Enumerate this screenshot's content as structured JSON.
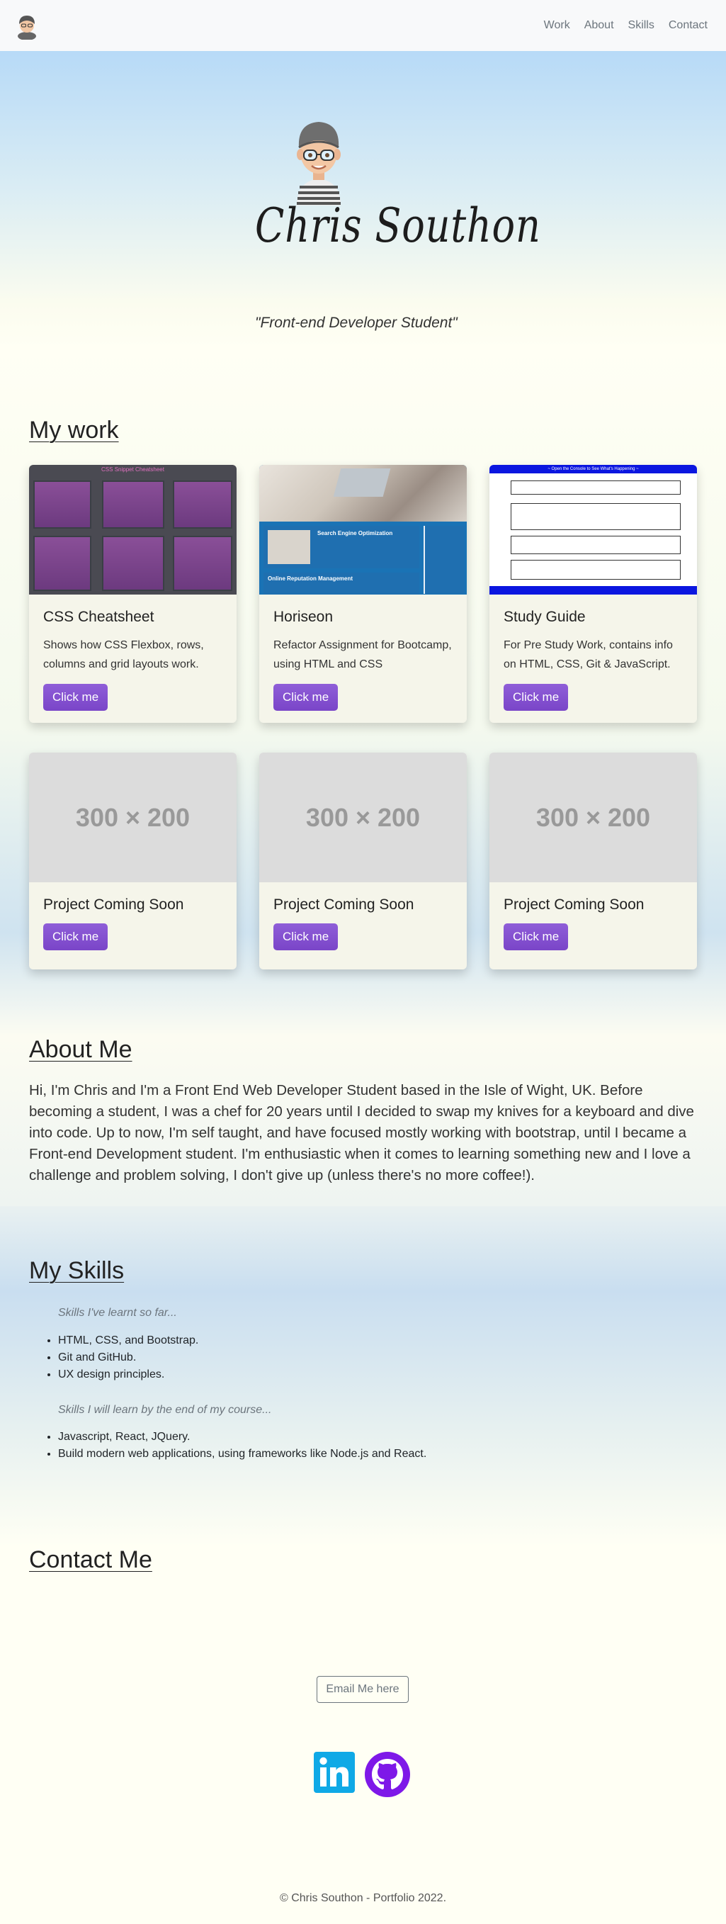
{
  "nav": {
    "logo_icon": "memoji-avatar-icon",
    "links": [
      "Work",
      "About",
      "Skills",
      "Contact"
    ]
  },
  "hero": {
    "name": "Chris Southon",
    "role": "\"Front-end Developer Student\"",
    "avatar_icon": "memoji-avatar-icon"
  },
  "work": {
    "heading": "My work",
    "projects": [
      {
        "title": "CSS Cheatsheet",
        "text": "Shows how CSS Flexbox, rows, columns and grid layouts work.",
        "button": "Click me",
        "thumb_title": "CSS Snippet Cheatsheet"
      },
      {
        "title": "Horiseon",
        "text": "Refactor Assignment for Bootcamp, using HTML and CSS",
        "button": "Click me",
        "thumb_title": "Search Engine Optimization",
        "thumb_title_2": "Online Reputation Management"
      },
      {
        "title": "Study Guide",
        "text": "For Pre Study Work, contains info on HTML, CSS, Git & JavaScript.",
        "button": "Click me",
        "thumb_title": "~ Open the Console to See What's Happening ~"
      }
    ],
    "coming_soon": [
      {
        "placeholder": "300 × 200",
        "title": "Project Coming Soon",
        "button": "Click me"
      },
      {
        "placeholder": "300 × 200",
        "title": "Project Coming Soon",
        "button": "Click me"
      },
      {
        "placeholder": "300 × 200",
        "title": "Project Coming Soon",
        "button": "Click me"
      }
    ]
  },
  "about": {
    "heading": "About Me",
    "text": "Hi, I'm Chris and I'm a Front End Web Developer Student based in the Isle of Wight, UK. Before becoming a student, I was a chef for 20 years until I decided to swap my knives for a keyboard and dive into code. Up to now, I'm self taught, and have focused mostly working with bootstrap, until I became a Front-end Development student. I'm enthusiastic when it comes to learning something new and I love a challenge and problem solving, I don't give up (unless there's no more coffee!)."
  },
  "skills": {
    "heading": "My Skills",
    "learnt_caption": "Skills I've learnt so far...",
    "learnt": [
      "HTML, CSS, and Bootstrap.",
      "Git and GitHub.",
      "UX design principles."
    ],
    "future_caption": "Skills I will learn by the end of my course...",
    "future": [
      "Javascript, React, JQuery.",
      "Build modern web applications, using frameworks like Node.js and React."
    ]
  },
  "contact": {
    "heading": "Contact Me",
    "email_button": "Email Me here",
    "socials": [
      "linkedin-icon",
      "github-icon"
    ]
  },
  "footer": {
    "text": "© Chris Southon - Portfolio 2022."
  },
  "colors": {
    "accent": "#7e4fcf",
    "linkedin": "#0fa9e6",
    "github": "#7e18e8"
  }
}
